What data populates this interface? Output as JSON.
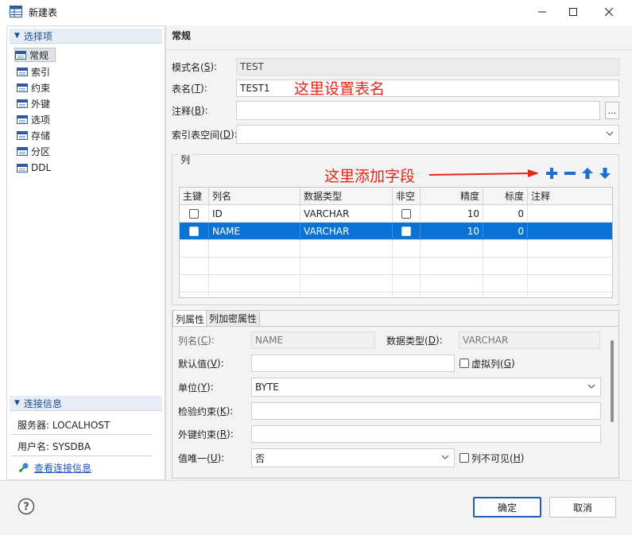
{
  "window": {
    "title": "新建表"
  },
  "sidebar": {
    "section_title": "选择项",
    "items": [
      {
        "label": "常规"
      },
      {
        "label": "索引"
      },
      {
        "label": "约束"
      },
      {
        "label": "外键"
      },
      {
        "label": "选项"
      },
      {
        "label": "存储"
      },
      {
        "label": "分区"
      },
      {
        "label": "DDL"
      }
    ],
    "conn_title": "连接信息",
    "server": "服务器: LOCALHOST",
    "user": "用户名: SYSDBA",
    "view_link": "查看连接信息"
  },
  "general": {
    "title": "常规",
    "schema_label": "模式名(",
    "schema_key": "S",
    "schema_value": "TEST",
    "table_label": "表名(",
    "table_key": "T",
    "table_value": "TEST1",
    "comment_label": "注释(",
    "comment_key": "B",
    "comment_value": "",
    "more_btn": "...",
    "tablespace_label": "索引表空间(",
    "tablespace_key": "D",
    "tablespace_value": "",
    "close_paren": "):",
    "annot_table": "这里设置表名"
  },
  "columns": {
    "group_title": "列",
    "annot_add": "这里添加字段",
    "headers": [
      "主键",
      "列名",
      "数据类型",
      "非空",
      "精度",
      "标度",
      "注释"
    ],
    "rows": [
      {
        "pk": false,
        "name": "ID",
        "type": "VARCHAR",
        "notnull": false,
        "precision": "10",
        "scale": "0",
        "comment": "",
        "selected": false
      },
      {
        "pk": false,
        "name": "NAME",
        "type": "VARCHAR",
        "notnull": false,
        "precision": "10",
        "scale": "0",
        "comment": "",
        "selected": true
      }
    ]
  },
  "props": {
    "tab_props": "列属性",
    "tab_encrypt": "列加密属性",
    "colname_label": "列名(",
    "colname_key": "C",
    "colname_value": "NAME",
    "datatype_label": "数据类型(",
    "datatype_key": "D",
    "datatype_value": "VARCHAR",
    "default_label": "默认值(",
    "default_key": "V",
    "default_value": "",
    "virtual_label": "虚拟列(",
    "virtual_key": "G",
    "unit_label": "单位(",
    "unit_key": "Y",
    "unit_value": "BYTE",
    "check_label": "检验约束(",
    "check_key": "K",
    "check_value": "",
    "fk_label": "外键约束(",
    "fk_key": "R",
    "fk_value": "",
    "unique_label": "值唯一(",
    "unique_key": "U",
    "unique_value": "否",
    "invisible_label": "列不可见(",
    "invisible_key": "H",
    "close_paren": "):",
    "close_paren2": ")"
  },
  "footer": {
    "ok": "确定",
    "cancel": "取消"
  },
  "colors": {
    "selection": "#0a73d6",
    "annotation": "#e8251b",
    "link": "#1a55c4",
    "toolbar_icon": "#1a6fd0"
  }
}
